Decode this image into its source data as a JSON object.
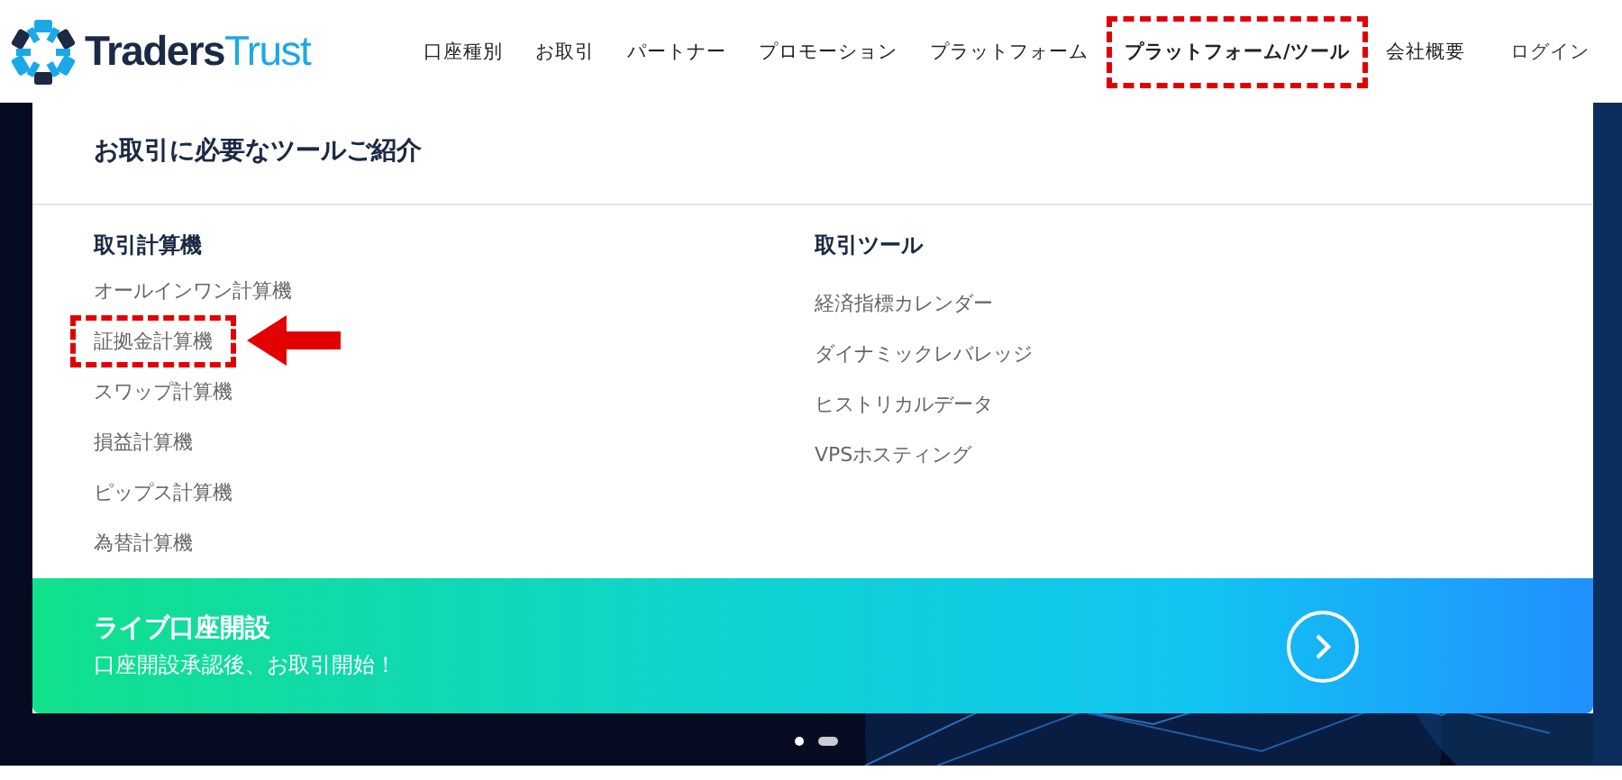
{
  "logo": {
    "text_dark": "Traders",
    "text_light": "Trust"
  },
  "nav": [
    {
      "label": "口座種別",
      "selected": false,
      "annotated": false
    },
    {
      "label": "お取引",
      "selected": false,
      "annotated": false
    },
    {
      "label": "パートナー",
      "selected": false,
      "annotated": false
    },
    {
      "label": "プロモーション",
      "selected": false,
      "annotated": false
    },
    {
      "label": "プラットフォーム",
      "selected": false,
      "annotated": false
    },
    {
      "label": "プラットフォーム/ツール",
      "selected": true,
      "annotated": true
    },
    {
      "label": "会社概要",
      "selected": false,
      "annotated": false
    }
  ],
  "login": "ログイン",
  "menu": {
    "title": "お取引に必要なツールご紹介",
    "columns": [
      {
        "heading": "取引計算機",
        "items": [
          {
            "label": "オールインワン計算機",
            "annotated": false
          },
          {
            "label": "証拠金計算機",
            "annotated": true
          },
          {
            "label": "スワップ計算機",
            "annotated": false
          },
          {
            "label": "損益計算機",
            "annotated": false
          },
          {
            "label": "ピップス計算機",
            "annotated": false
          },
          {
            "label": "為替計算機",
            "annotated": false
          }
        ]
      },
      {
        "heading": "取引ツール",
        "items": [
          {
            "label": "経済指標カレンダー",
            "annotated": false
          },
          {
            "label": "ダイナミックレバレッジ",
            "annotated": false
          },
          {
            "label": "ヒストリカルデータ",
            "annotated": false
          },
          {
            "label": "VPSホスティング",
            "annotated": false
          }
        ]
      }
    ]
  },
  "banner": {
    "title": "ライブ口座開設",
    "subtitle": "口座開設承認後、お取引開始！"
  },
  "carousel": {
    "dots": [
      {
        "selected": false
      },
      {
        "selected": true
      }
    ]
  }
}
